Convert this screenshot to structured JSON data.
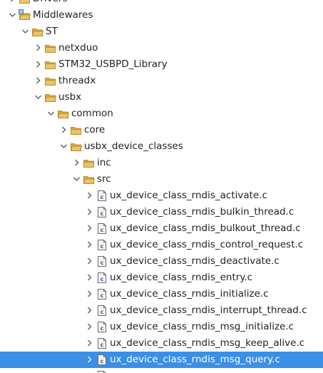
{
  "project_explorer": {
    "items": [
      {
        "label": "Drivers",
        "kind": "folder",
        "expanded": false,
        "depth": 0,
        "partial": true,
        "special": false
      },
      {
        "label": "Middlewares",
        "kind": "folder",
        "expanded": true,
        "depth": 0,
        "special": true
      },
      {
        "label": "ST",
        "kind": "folder",
        "expanded": true,
        "depth": 1
      },
      {
        "label": "netxduo",
        "kind": "folder",
        "expanded": false,
        "depth": 2
      },
      {
        "label": "STM32_USBPD_Library",
        "kind": "folder",
        "expanded": false,
        "depth": 2
      },
      {
        "label": "threadx",
        "kind": "folder",
        "expanded": false,
        "depth": 2
      },
      {
        "label": "usbx",
        "kind": "folder",
        "expanded": true,
        "depth": 2
      },
      {
        "label": "common",
        "kind": "folder",
        "expanded": true,
        "depth": 3
      },
      {
        "label": "core",
        "kind": "folder",
        "expanded": false,
        "depth": 4
      },
      {
        "label": "usbx_device_classes",
        "kind": "folder",
        "expanded": true,
        "depth": 4
      },
      {
        "label": "inc",
        "kind": "folder",
        "expanded": false,
        "depth": 5
      },
      {
        "label": "src",
        "kind": "folder",
        "expanded": true,
        "depth": 5
      },
      {
        "label": "ux_device_class_rndis_activate.c",
        "kind": "c-file",
        "expanded": false,
        "depth": 6
      },
      {
        "label": "ux_device_class_rndis_bulkin_thread.c",
        "kind": "c-file",
        "expanded": false,
        "depth": 6
      },
      {
        "label": "ux_device_class_rndis_bulkout_thread.c",
        "kind": "c-file",
        "expanded": false,
        "depth": 6
      },
      {
        "label": "ux_device_class_rndis_control_request.c",
        "kind": "c-file",
        "expanded": false,
        "depth": 6
      },
      {
        "label": "ux_device_class_rndis_deactivate.c",
        "kind": "c-file",
        "expanded": false,
        "depth": 6
      },
      {
        "label": "ux_device_class_rndis_entry.c",
        "kind": "c-file",
        "expanded": false,
        "depth": 6
      },
      {
        "label": "ux_device_class_rndis_initialize.c",
        "kind": "c-file",
        "expanded": false,
        "depth": 6
      },
      {
        "label": "ux_device_class_rndis_interrupt_thread.c",
        "kind": "c-file",
        "expanded": false,
        "depth": 6
      },
      {
        "label": "ux_device_class_rndis_msg_initialize.c",
        "kind": "c-file",
        "expanded": false,
        "depth": 6
      },
      {
        "label": "ux_device_class_rndis_msg_keep_alive.c",
        "kind": "c-file",
        "expanded": false,
        "depth": 6
      },
      {
        "label": "ux_device_class_rndis_msg_query.c",
        "kind": "c-file",
        "expanded": false,
        "depth": 6,
        "selected": true
      },
      {
        "label": "",
        "kind": "c-file",
        "expanded": false,
        "depth": 6,
        "partial": true
      }
    ]
  },
  "colors": {
    "selection": "#3a8fe6",
    "folder": "#e9c46a",
    "folder_stroke": "#b8902e",
    "twisty": "#555555",
    "text": "#222222"
  },
  "icons": {
    "folder": "folder-icon",
    "c_file": "c-source-file-icon",
    "collapsed": "chevron-right-icon",
    "expanded": "chevron-down-icon"
  }
}
